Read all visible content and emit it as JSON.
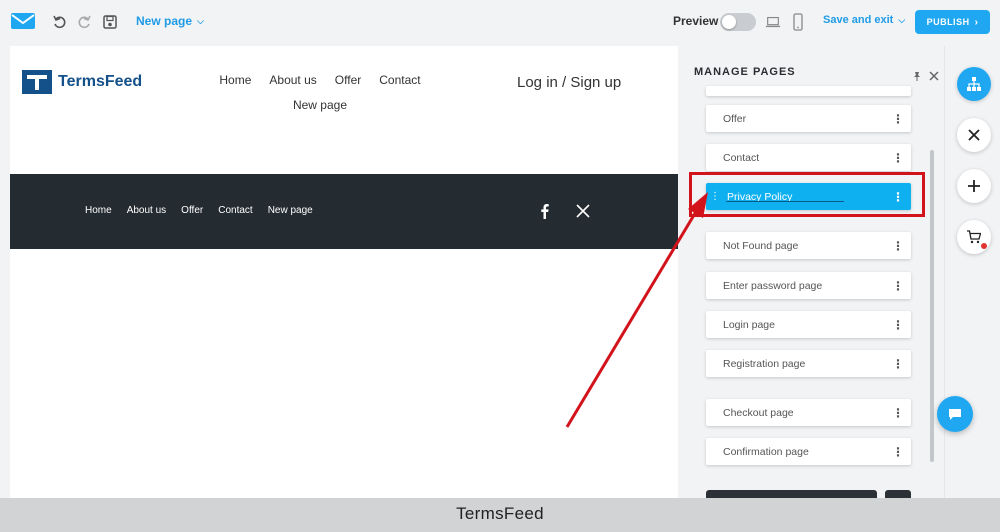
{
  "toolbar": {
    "page_name": "New page",
    "preview_label": "Preview",
    "save_exit_label": "Save and exit",
    "publish_label": "PUBLISH"
  },
  "site": {
    "brand": "TermsFeed",
    "header_nav": [
      "Home",
      "About us",
      "Offer",
      "Contact",
      "New page"
    ],
    "login_text": "Log in / Sign up",
    "footer_nav": [
      "Home",
      "About us",
      "Offer",
      "Contact",
      "New page"
    ],
    "social": [
      "facebook-icon",
      "x-icon"
    ],
    "footer_bg": "#242b31"
  },
  "panel": {
    "title": "MANAGE PAGES",
    "pages": [
      {
        "label": "Offer"
      },
      {
        "label": "Contact"
      },
      {
        "label": "Privacy Policy",
        "active": true
      },
      {
        "label": "Not Found page"
      },
      {
        "label": "Enter password page"
      },
      {
        "label": "Login page"
      },
      {
        "label": "Registration page"
      },
      {
        "label": "Checkout page"
      },
      {
        "label": "Confirmation page"
      }
    ],
    "active_color": "#0fb0f0"
  },
  "sidebar": {
    "buttons": [
      "sitemap-icon",
      "close-icon",
      "plus-icon",
      "cart-icon"
    ],
    "chat": "chat-icon"
  },
  "caption": "TermsFeed",
  "colors": {
    "accent": "#1fa8f1",
    "highlight": "#d3131b"
  }
}
